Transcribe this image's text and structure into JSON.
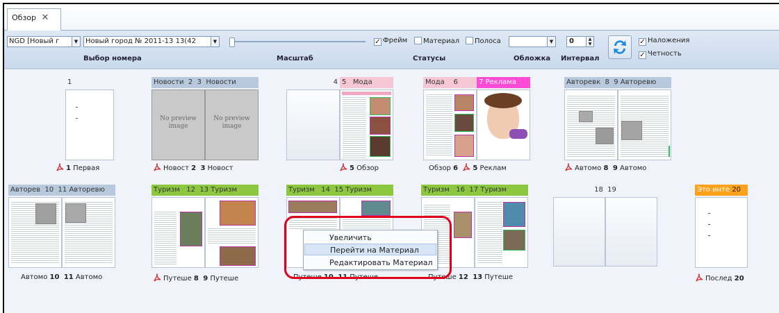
{
  "tab": {
    "label": "Обзор"
  },
  "toolbar": {
    "issue_combo": "NGD [Новый г",
    "issue_combo2": "Новый город № 2011-13 13(42",
    "label_issue": "Выбор номера",
    "label_scale": "Масштаб",
    "label_status": "Статусы",
    "label_cover": "Обложка",
    "label_interval": "Интервал",
    "frame_label": "Фрейм",
    "material_label": "Материал",
    "stripe_label": "Полоса",
    "interval_value": "0",
    "overlay_label": "Наложения",
    "parity_label": "Четность"
  },
  "spreads": [
    {
      "headers": [
        "1"
      ],
      "footer": [
        "1",
        "Первая"
      ],
      "pdf": true
    },
    {
      "headers": [
        "Новости",
        "2",
        "3",
        "Новости"
      ],
      "footer": [
        "Новост",
        "2",
        "3",
        "Новост"
      ],
      "pdf": true,
      "noprev": "No preview image"
    },
    {
      "headers": [
        "4",
        "5",
        "Мода"
      ],
      "footer": [
        "5",
        "Обзор"
      ],
      "pdf": true
    },
    {
      "headers": [
        "Мода",
        "6",
        "7",
        "Реклама"
      ],
      "footer": [
        "Обзор",
        "6",
        "5",
        "Реклам"
      ],
      "pdf": true
    },
    {
      "headers": [
        "Авторевк",
        "8",
        "9",
        "Авторевю"
      ],
      "footer": [
        "Автомо",
        "8",
        "9",
        "Автомо"
      ],
      "pdf": true
    },
    {
      "headers": [
        "Авторев",
        "10",
        "11",
        "Авторевю"
      ],
      "footer": [
        "Автомо",
        "10",
        "11",
        "Автомо"
      ],
      "pdf": false
    },
    {
      "headers": [
        "Туризм",
        "12",
        "13",
        "Туризм"
      ],
      "footer": [
        "Путеше",
        "8",
        "9",
        "Путеше"
      ],
      "pdf": true
    },
    {
      "headers": [
        "Туризм",
        "14",
        "15",
        "Туризм"
      ],
      "footer": [
        "Путеше",
        "10",
        "11",
        "Путеше"
      ],
      "pdf": false
    },
    {
      "headers": [
        "Туризм",
        "16",
        "17",
        "Туризм"
      ],
      "footer": [
        "Путеше",
        "12",
        "13",
        "Путеше"
      ],
      "pdf": false
    },
    {
      "headers": [
        "18",
        "19"
      ],
      "footer": [],
      "pdf": false
    },
    {
      "headers": [
        "Это инте",
        "20"
      ],
      "footer": [
        "Послед",
        "20"
      ],
      "pdf": true
    }
  ],
  "context_menu": {
    "items": [
      "Увеличить",
      "Перейти на Материал",
      "Редактировать Материал"
    ]
  },
  "colors": {
    "news": "#b9c9dd",
    "fashion": "#f6c8d6",
    "ads": "#ff4bd5",
    "auto": "#b9c9dd",
    "tourism": "#8dc63f",
    "info": "#ffa11a",
    "highlight": "#e0001b"
  }
}
